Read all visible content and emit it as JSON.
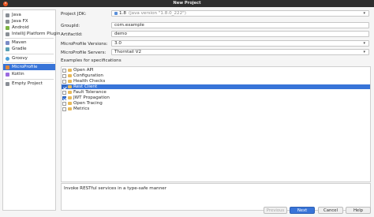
{
  "window": {
    "title": "New Project"
  },
  "sidebar": {
    "items": [
      {
        "label": "Java",
        "icon": "java-icon",
        "color": "#8a8f96"
      },
      {
        "label": "Java FX",
        "icon": "javafx-icon",
        "color": "#8a8f96"
      },
      {
        "label": "Android",
        "icon": "android-icon",
        "color": "#7cb342"
      },
      {
        "label": "IntelliJ Platform Plugin",
        "icon": "plugin-icon",
        "color": "#8a8f96"
      },
      {
        "label": "Maven",
        "icon": "maven-icon",
        "color": "#7b8cc7"
      },
      {
        "label": "Gradle",
        "icon": "gradle-icon",
        "color": "#5aa0b4"
      },
      {
        "label": "Groovy",
        "icon": "groovy-icon",
        "color": "#4a9fd8"
      },
      {
        "label": "MicroProfile",
        "icon": "microprofile-icon",
        "color": "#e0853a",
        "selected": true
      },
      {
        "label": "Kotlin",
        "icon": "kotlin-icon",
        "color": "#9b6ae0"
      },
      {
        "label": "Empty Project",
        "icon": "folder-icon",
        "color": "#8a8f96"
      }
    ]
  },
  "form": {
    "jdk_label": "Project JDK:",
    "jdk_value": "1.8",
    "jdk_detail": "(java version \"1.8.0_222\")",
    "groupid_label": "GroupId:",
    "groupid_value": "com.example",
    "artifactid_label": "ArtifactId:",
    "artifactid_value": "demo",
    "versions_label": "MicroProfile Versions:",
    "versions_value": "3.0",
    "servers_label": "MicroProfile Servers:",
    "servers_value": "Thorntail V2"
  },
  "examples": {
    "label": "Examples for specifications",
    "items": [
      {
        "label": "Open API",
        "checked": false
      },
      {
        "label": "Configuration",
        "checked": false
      },
      {
        "label": "Health Checks",
        "checked": false
      },
      {
        "label": "Rest Client",
        "checked": true,
        "selected": true
      },
      {
        "label": "Fault Tolerance",
        "checked": false
      },
      {
        "label": "JWT Propagation",
        "checked": true
      },
      {
        "label": "Open Tracing",
        "checked": false
      },
      {
        "label": "Metrics",
        "checked": false
      }
    ]
  },
  "description": "Invoke RESTful services in a type-safe manner",
  "buttons": {
    "previous": "Previous",
    "next": "Next",
    "cancel": "Cancel",
    "help": "Help"
  }
}
